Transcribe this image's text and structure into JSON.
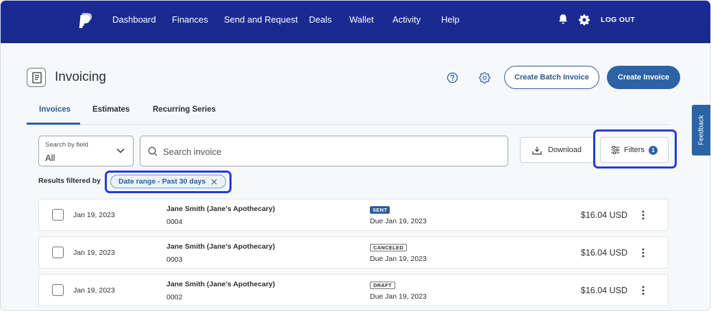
{
  "nav": {
    "items": [
      "Dashboard",
      "Finances",
      "Send and Request",
      "Deals",
      "Wallet",
      "Activity",
      "Help"
    ],
    "logout": "LOG OUT",
    "bg_color": "#1b2a94"
  },
  "header": {
    "title": "Invoicing",
    "create_batch_label": "Create Batch Invoice",
    "create_invoice_label": "Create Invoice"
  },
  "tabs": [
    {
      "label": "Invoices",
      "active": true
    },
    {
      "label": "Estimates",
      "active": false
    },
    {
      "label": "Recurring Series",
      "active": false
    }
  ],
  "filters": {
    "search_by_label": "Search by field",
    "search_by_value": "All",
    "search_placeholder": "Search invoice",
    "download_label": "Download",
    "filters_label": "Filters",
    "filters_count": "1",
    "results_label": "Results filtered by",
    "chip_label": "Date range - Past 30 days"
  },
  "invoices": [
    {
      "date": "Jan 19, 2023",
      "customer": "Jane Smith (Jane's Apothecary)",
      "number": "0004",
      "status": "SENT",
      "due": "Due Jan 19, 2023",
      "amount": "$16.04 USD"
    },
    {
      "date": "Jan 19, 2023",
      "customer": "Jane Smith (Jane's Apothecary)",
      "number": "0003",
      "status": "CANCELED",
      "due": "Due Jan 19, 2023",
      "amount": "$16.04 USD"
    },
    {
      "date": "Jan 19, 2023",
      "customer": "Jane Smith (Jane's Apothecary)",
      "number": "0002",
      "status": "DRAFT",
      "due": "Due Jan 19, 2023",
      "amount": "$16.04 USD"
    }
  ],
  "feedback_label": "Feedback",
  "colors": {
    "accent": "#2b63a6",
    "highlight": "#1f3bd6"
  }
}
